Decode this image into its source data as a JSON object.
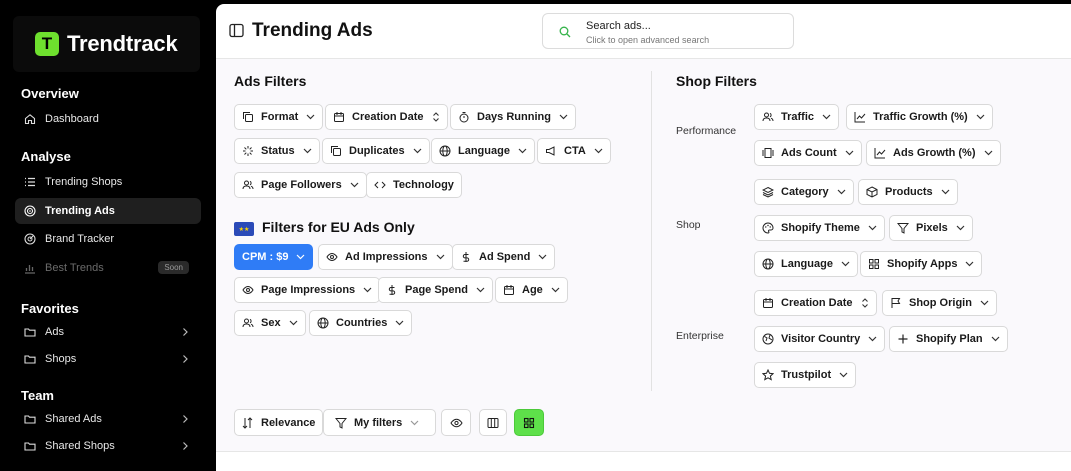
{
  "brand": {
    "logo_glyph": "T",
    "name": "Trendtrack",
    "accent": "#6ee02e"
  },
  "sidebar": {
    "overview": {
      "title": "Overview",
      "items": [
        {
          "label": "Dashboard",
          "icon": "home-icon"
        }
      ]
    },
    "analyse": {
      "title": "Analyse",
      "items": [
        {
          "label": "Trending Shops",
          "icon": "list-icon"
        },
        {
          "label": "Trending Ads",
          "icon": "target-icon",
          "active": true
        },
        {
          "label": "Brand Tracker",
          "icon": "radar-icon"
        },
        {
          "label": "Best Trends",
          "icon": "chart-icon",
          "badge": "Soon"
        }
      ]
    },
    "favorites": {
      "title": "Favorites",
      "items": [
        {
          "label": "Ads",
          "icon": "folder-icon"
        },
        {
          "label": "Shops",
          "icon": "folder-icon"
        }
      ]
    },
    "team": {
      "title": "Team",
      "items": [
        {
          "label": "Shared Ads",
          "icon": "folder-icon"
        },
        {
          "label": "Shared Shops",
          "icon": "folder-icon"
        }
      ]
    }
  },
  "header": {
    "title": "Trending Ads",
    "search_title": "Search ads...",
    "search_sub": "Click to open advanced search"
  },
  "ads_filters": {
    "title": "Ads Filters",
    "buttons": [
      "Format",
      "Creation Date",
      "Days Running",
      "Status",
      "Duplicates",
      "Language",
      "CTA",
      "Page Followers",
      "Technology"
    ]
  },
  "eu_filters": {
    "title": "Filters for EU Ads Only",
    "buttons": [
      "CPM : $9",
      "Ad Impressions",
      "Ad Spend",
      "Page Impressions",
      "Page Spend",
      "Age",
      "Sex",
      "Countries"
    ]
  },
  "shop_filters": {
    "title": "Shop Filters",
    "groups": {
      "performance": "Performance",
      "shop": "Shop",
      "enterprise": "Enterprise"
    },
    "buttons": [
      "Traffic",
      "Traffic Growth (%)",
      "Ads Count",
      "Ads Growth (%)",
      "Category",
      "Products",
      "Shopify Theme",
      "Pixels",
      "Language",
      "Shopify Apps",
      "Creation Date",
      "Shop Origin",
      "Visitor Country",
      "Shopify Plan",
      "Trustpilot"
    ]
  },
  "toolbar": {
    "sort_label": "Relevance",
    "filters_label": "My filters",
    "active_view_color": "#5ee04a"
  }
}
